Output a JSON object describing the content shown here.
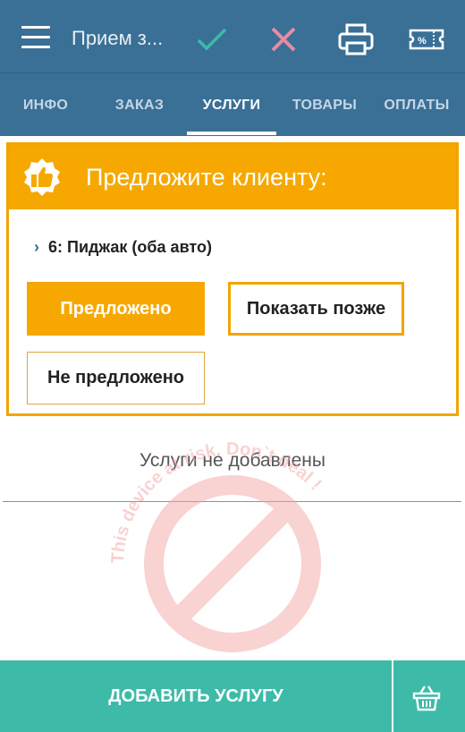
{
  "header": {
    "title": "Прием з...",
    "icons": [
      "menu-icon",
      "check-icon",
      "close-icon",
      "printer-icon",
      "discount-ticket-icon"
    ],
    "colors": {
      "bar": "#3a6f96",
      "check": "#3dbaa8",
      "close": "#e58ca6"
    }
  },
  "tabs": [
    {
      "label": "ИНФО",
      "active": false
    },
    {
      "label": "ЗАКАЗ",
      "active": false
    },
    {
      "label": "УСЛУГИ",
      "active": true
    },
    {
      "label": "ТОВАРЫ",
      "active": false
    },
    {
      "label": "ОПЛАТЫ",
      "active": false
    }
  ],
  "suggestion": {
    "title": "Предложите клиенту:",
    "icon": "thumbs-up-badge-icon",
    "item": "6: Пиджак (оба авто)",
    "buttons": {
      "offered": "Предложено",
      "show_later": "Показать позже",
      "not_offered": "Не предложено"
    },
    "accent_color": "#f6a800"
  },
  "services_empty_text": "Услуги не добавлены",
  "watermark": {
    "text": "This device at risk. Don`t deal !",
    "icon": "prohibited-sign-icon"
  },
  "bottom_bar": {
    "add_label": "ДОБАВИТЬ УСЛУГУ",
    "icon": "basket-icon",
    "color": "#3dbaa8"
  }
}
